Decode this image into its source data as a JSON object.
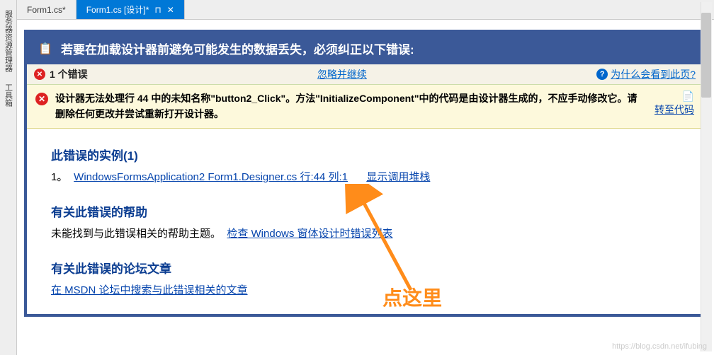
{
  "sidebar": {
    "tabs": [
      "服务器资源管理器",
      "工具箱"
    ]
  },
  "tabs": [
    {
      "label": "Form1.cs*"
    },
    {
      "label": "Form1.cs [设计]*"
    }
  ],
  "header": {
    "title": "若要在加载设计器前避免可能发生的数据丢失，必须纠正以下错误:"
  },
  "subbar": {
    "error_count": "1 个错误",
    "ignore": "忽略并继续",
    "why": "为什么会看到此页?"
  },
  "error": {
    "message": "设计器无法处理行 44 中的未知名称\"button2_Click\"。方法\"InitializeComponent\"中的代码是由设计器生成的，不应手动修改它。请删除任何更改并尝试重新打开设计器。",
    "goto_code": "转至代码"
  },
  "instances": {
    "title": "此错误的实例(1)",
    "num": "1。",
    "link": "WindowsFormsApplication2 Form1.Designer.cs 行:44 列:1",
    "stack": "显示调用堆栈"
  },
  "help": {
    "title": "有关此错误的帮助",
    "text": "未能找到与此错误相关的帮助主题。",
    "link": "检查 Windows 窗体设计时错误列表"
  },
  "forum": {
    "title": "有关此错误的论坛文章",
    "link": "在 MSDN 论坛中搜索与此错误相关的文章"
  },
  "annotation": "点这里",
  "watermark": "https://blog.csdn.net/ifubing"
}
